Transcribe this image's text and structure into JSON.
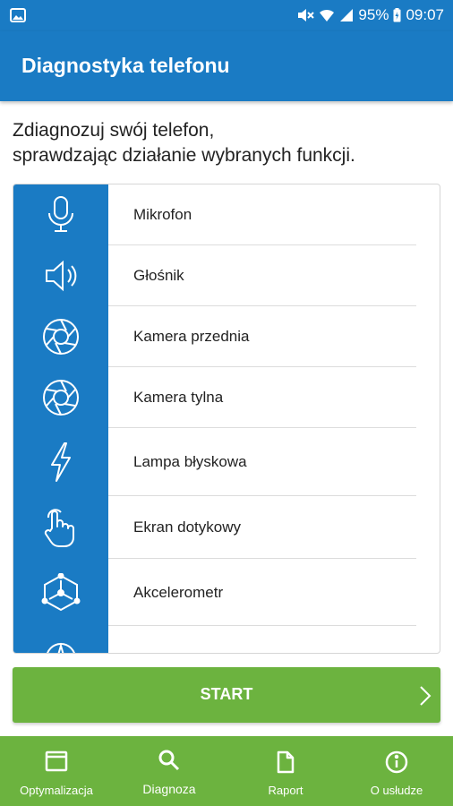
{
  "status_bar": {
    "battery": "95%",
    "time": "09:07"
  },
  "app_bar": {
    "title": "Diagnostyka telefonu"
  },
  "intro": {
    "line1": "Zdiagnozuj swój telefon,",
    "line2": "sprawdzając działanie wybranych funkcji."
  },
  "tests": [
    {
      "label": "Mikrofon",
      "icon": "microphone-icon"
    },
    {
      "label": "Głośnik",
      "icon": "speaker-icon"
    },
    {
      "label": "Kamera przednia",
      "icon": "aperture-icon"
    },
    {
      "label": "Kamera tylna",
      "icon": "aperture-icon"
    },
    {
      "label": "Lampa błyskowa",
      "icon": "lightning-icon"
    },
    {
      "label": "Ekran dotykowy",
      "icon": "touch-hand-icon"
    },
    {
      "label": "Akcelerometr",
      "icon": "accelerometer-icon"
    },
    {
      "label": "",
      "icon": "compass-icon"
    }
  ],
  "start_button": {
    "label": "START"
  },
  "bottom_nav": [
    {
      "label": "Optymalizacja",
      "icon": "window-icon"
    },
    {
      "label": "Diagnoza",
      "icon": "search-icon"
    },
    {
      "label": "Raport",
      "icon": "document-icon"
    },
    {
      "label": "O usłudze",
      "icon": "info-icon"
    }
  ],
  "colors": {
    "primary_blue": "#1a7bc4",
    "accent_green": "#6cb33f"
  }
}
